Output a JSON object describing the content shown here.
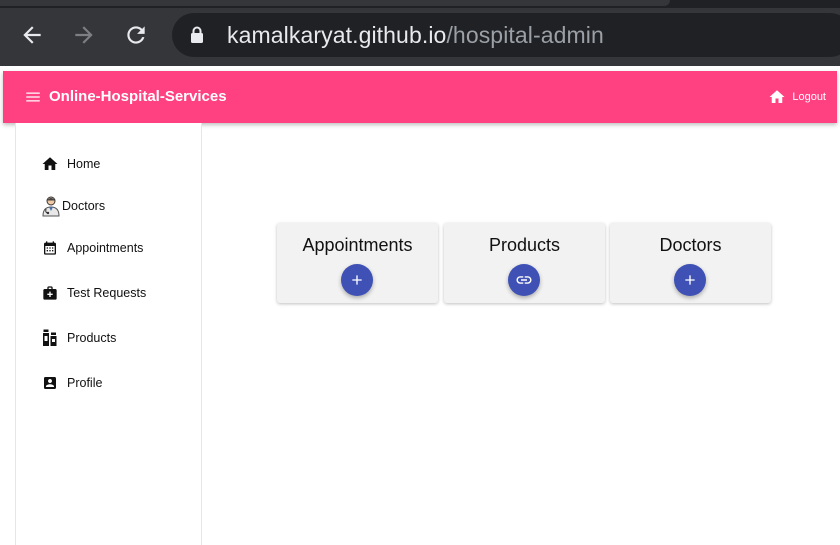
{
  "browser": {
    "url_host": "kamalkaryat.github.io",
    "url_path": "/hospital-admin",
    "icons": [
      "back-arrow-icon",
      "forward-arrow-icon",
      "reload-icon",
      "lock-icon"
    ]
  },
  "appbar": {
    "title": "Online-Hospital-Services",
    "logout_label": "Logout",
    "color": "#ff4081",
    "icons": [
      "menu-icon",
      "home-icon"
    ]
  },
  "sidebar": {
    "items": [
      {
        "label": "Home",
        "icon": "home-icon"
      },
      {
        "label": "Doctors",
        "icon": "doctor-icon"
      },
      {
        "label": "Appointments",
        "icon": "calendar-icon"
      },
      {
        "label": "Test Requests",
        "icon": "medical-bag-icon"
      },
      {
        "label": "Products",
        "icon": "bottles-icon"
      },
      {
        "label": "Profile",
        "icon": "account-box-icon"
      }
    ]
  },
  "cards": [
    {
      "title": "Appointments",
      "icon": "plus-icon"
    },
    {
      "title": "Products",
      "icon": "link-icon"
    },
    {
      "title": "Doctors",
      "icon": "plus-icon"
    }
  ],
  "accent_color": "#3f51b5"
}
